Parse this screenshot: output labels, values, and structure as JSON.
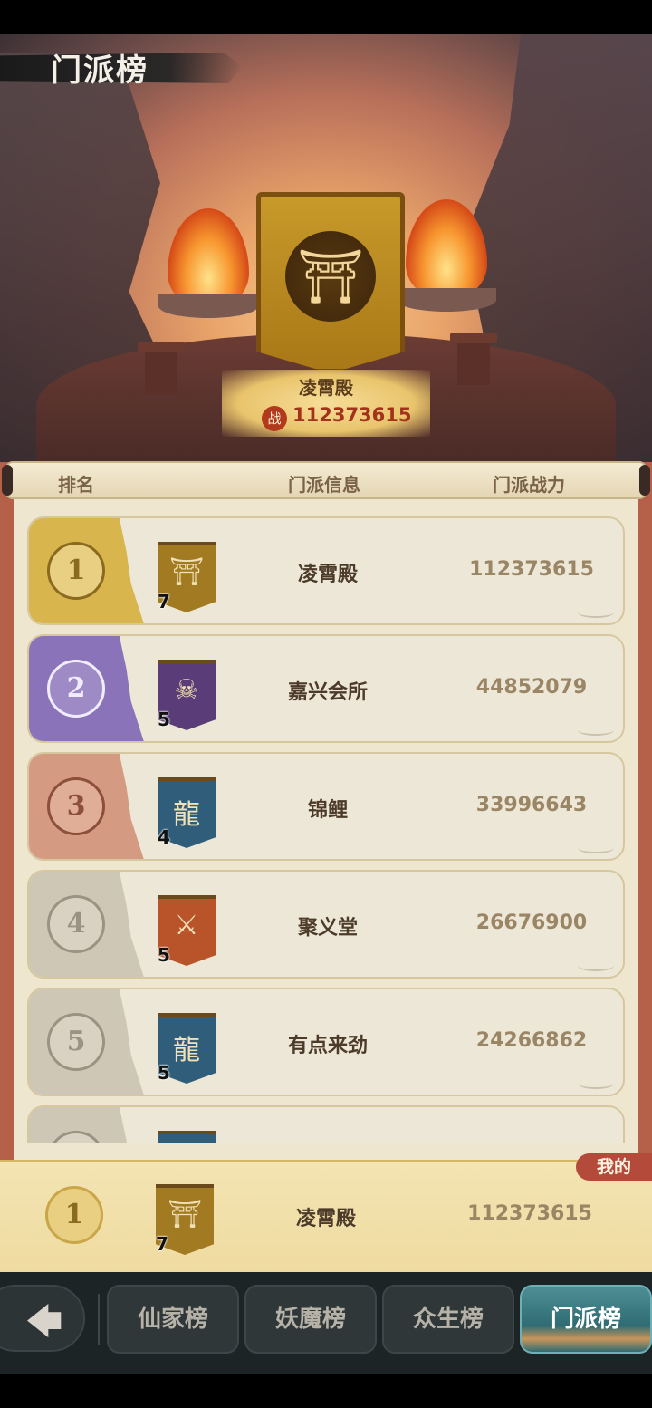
{
  "header": {
    "title": "门派榜"
  },
  "top_sect": {
    "name": "凌霄殿",
    "power_icon": "战",
    "power": "112373615"
  },
  "table_headers": {
    "rank": "排名",
    "info": "门派信息",
    "power": "门派战力"
  },
  "rows": [
    {
      "rank": "1",
      "level": "7",
      "name": "凌霄殿",
      "power": "112373615",
      "tint": "#d9b54d",
      "medal_bg": "#e9cf82",
      "medal_fg": "#8a6a20",
      "flag_bg": "#a27a22",
      "flag_glyph": "⛩"
    },
    {
      "rank": "2",
      "level": "5",
      "name": "嘉兴会所",
      "power": "44852079",
      "tint": "#8a73b8",
      "medal_bg": "#9e8bc6",
      "medal_fg": "#f2ecff",
      "flag_bg": "#5a3d78",
      "flag_glyph": "☠"
    },
    {
      "rank": "3",
      "level": "4",
      "name": "锦鲤",
      "power": "33996643",
      "tint": "#d59a82",
      "medal_bg": "#e0ad96",
      "medal_fg": "#8b4f3a",
      "flag_bg": "#2f5d7a",
      "flag_glyph": "龍"
    },
    {
      "rank": "4",
      "level": "5",
      "name": "聚义堂",
      "power": "26676900",
      "tint": "#cfc7b5",
      "medal_bg": "#d9d2c2",
      "medal_fg": "#9a9384",
      "flag_bg": "#b8532a",
      "flag_glyph": "⚔"
    },
    {
      "rank": "5",
      "level": "5",
      "name": "有点来劲",
      "power": "24266862",
      "tint": "#cfc7b5",
      "medal_bg": "#d9d2c2",
      "medal_fg": "#9a9384",
      "flag_bg": "#2f5d7a",
      "flag_glyph": "龍"
    },
    {
      "rank": "",
      "level": "",
      "name": "",
      "power": "",
      "tint": "#cfc7b5",
      "medal_bg": "#d9d2c2",
      "medal_fg": "#9a9384",
      "flag_bg": "#2f5d7a",
      "flag_glyph": ""
    }
  ],
  "my_row": {
    "tag": "我的",
    "rank": "1",
    "level": "7",
    "name": "凌霄殿",
    "power": "112373615"
  },
  "tabs": [
    {
      "label": "仙家榜",
      "active": false
    },
    {
      "label": "妖魔榜",
      "active": false
    },
    {
      "label": "众生榜",
      "active": false
    },
    {
      "label": "门派榜",
      "active": true
    }
  ],
  "back_icon": "arrow-left-icon"
}
